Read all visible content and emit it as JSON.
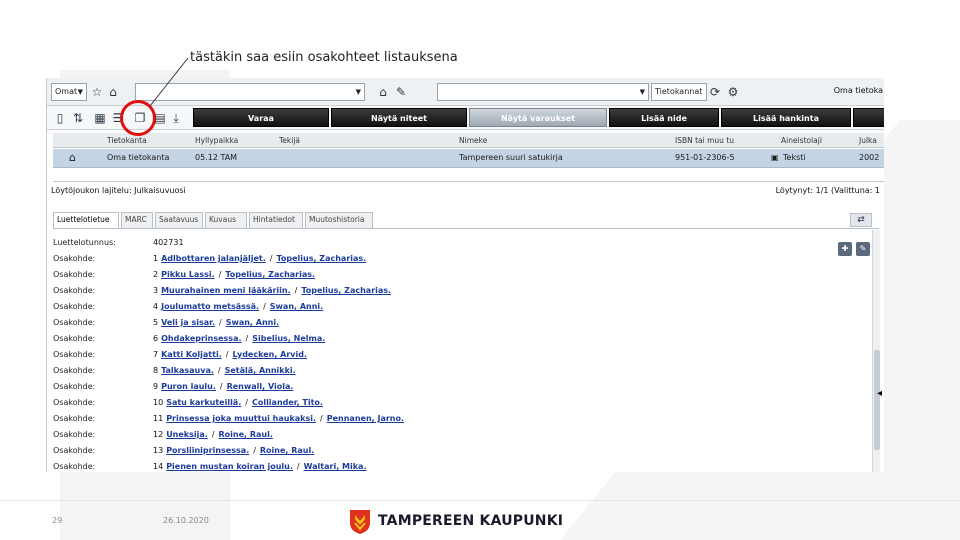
{
  "annotation": {
    "text": "tästäkin saa esiin osakohteet listauksena"
  },
  "toolbar1": {
    "select_left": "Omat",
    "select_right": "Tietokannat",
    "right_label": "Oma tietoka"
  },
  "toolbar2": {
    "buttons": [
      "Varaa",
      "Näytä niteet",
      "Näytä varaukset",
      "Lisää nide",
      "Lisää hankinta"
    ]
  },
  "grid": {
    "headers": [
      "Tietokanta",
      "Hyllypaikka",
      "Tekijä",
      "Nimeke",
      "ISBN tai muu tu",
      "Aineistolaji",
      "Julka"
    ],
    "row": [
      "Oma tietokanta",
      "05.12 TAM",
      "",
      "Tampereen suuri satukirja",
      "951-01-2306-5",
      "Teksti",
      "2002"
    ]
  },
  "status": {
    "left": "Löytöjoukon lajitelu: Julkaisuvuosi",
    "right": "Löytynyt: 1/1 (Valittuna: 1"
  },
  "tabs": [
    "Luettelotietue",
    "MARC",
    "Saatavuus",
    "Kuvaus",
    "Hintatiedot",
    "Muutoshistoria"
  ],
  "details": {
    "id_label": "Luettelotunnus:",
    "id_value": "402731",
    "item_label": "Osakohde:",
    "items": [
      {
        "num": "1",
        "title": "Adlbottaren jalanjäljet.",
        "author": "Topelius, Zacharias."
      },
      {
        "num": "2",
        "title": "Pikku Lassi.",
        "author": "Topelius, Zacharias."
      },
      {
        "num": "3",
        "title": "Muurahainen meni lääkäriin.",
        "author": "Topelius, Zacharias."
      },
      {
        "num": "4",
        "title": "Joulumatto metsässä.",
        "author": "Swan, Anni."
      },
      {
        "num": "5",
        "title": "Veli ja sisar.",
        "author": "Swan, Anni."
      },
      {
        "num": "6",
        "title": "Ohdakeprinsessa.",
        "author": "Sibelius, Nelma."
      },
      {
        "num": "7",
        "title": "Katti Koljatti.",
        "author": "Lydecken, Arvid."
      },
      {
        "num": "8",
        "title": "Talkasauva.",
        "author": "Setälä, Annikki."
      },
      {
        "num": "9",
        "title": "Puron laulu.",
        "author": "Renwall, Viola."
      },
      {
        "num": "10",
        "title": "Satu karkuteillä.",
        "author": "Colliander, Tito."
      },
      {
        "num": "11",
        "title": "Prinsessa joka muuttui haukaksi.",
        "author": "Pennanen, Jarno."
      },
      {
        "num": "12",
        "title": "Uneksija.",
        "author": "Roine, Raul."
      },
      {
        "num": "13",
        "title": "Porsliiniprinsessa.",
        "author": "Roine, Raul."
      },
      {
        "num": "14",
        "title": "Pienen mustan koiran joulu.",
        "author": "Waltari, Mika."
      }
    ]
  },
  "footer": {
    "page": "29",
    "date": "26.10.2020",
    "city": "TAMPEREEN KAUPUNKI"
  },
  "colors": {
    "highlight": "#e01010",
    "selected_row": "#c4d4e4",
    "link": "#1c3c9c"
  }
}
